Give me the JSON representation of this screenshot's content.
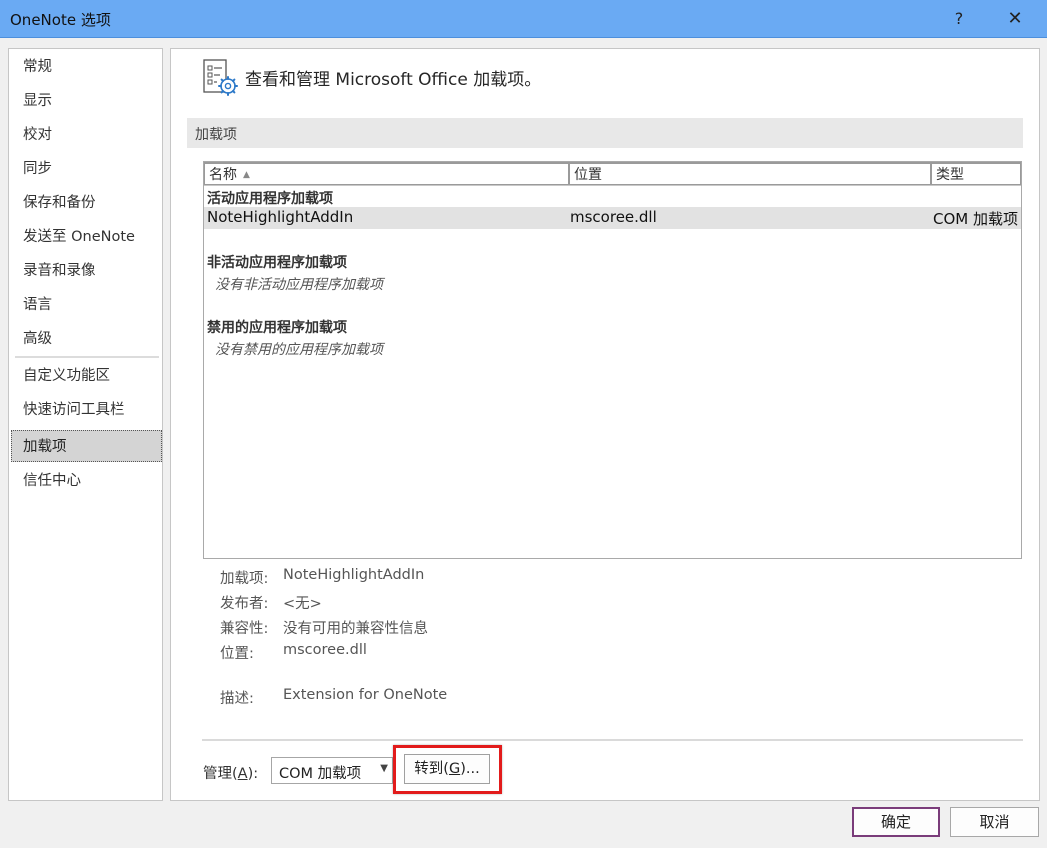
{
  "window": {
    "title": "OneNote 选项",
    "help": "?",
    "close": "✕"
  },
  "nav": {
    "items": [
      "常规",
      "显示",
      "校对",
      "同步",
      "保存和备份",
      "发送至 OneNote",
      "录音和录像",
      "语言",
      "高级",
      "自定义功能区",
      "快速访问工具栏",
      "加载项",
      "信任中心"
    ],
    "active": "加载项"
  },
  "main": {
    "heading": "查看和管理 Microsoft Office 加载项。",
    "section_title": "加载项",
    "columns": {
      "name": "名称",
      "location": "位置",
      "type": "类型"
    },
    "groups": {
      "active": "活动应用程序加载项",
      "inactive": "非活动应用程序加载项",
      "inactive_empty": "没有非活动应用程序加载项",
      "disabled": "禁用的应用程序加载项",
      "disabled_empty": "没有禁用的应用程序加载项"
    },
    "active_rows": [
      {
        "name": "NoteHighlightAddIn",
        "location": "mscoree.dll",
        "type": "COM 加载项"
      }
    ],
    "details": {
      "addin_label": "加载项:",
      "addin_value": "NoteHighlightAddIn",
      "publisher_label": "发布者:",
      "publisher_value": "<无>",
      "compat_label": "兼容性:",
      "compat_value": "没有可用的兼容性信息",
      "location_label": "位置:",
      "location_value": "mscoree.dll",
      "desc_label": "描述:",
      "desc_value": "Extension for OneNote"
    },
    "manage": {
      "label_prefix": "管理(",
      "label_key": "A",
      "label_suffix": "):",
      "selected": "COM 加载项",
      "go_prefix": "转到(",
      "go_key": "G",
      "go_suffix": ")..."
    }
  },
  "footer": {
    "ok": "确定",
    "cancel": "取消"
  },
  "colors": {
    "titlebar": "#6aaaf3",
    "highlight_box": "#e21b1b",
    "ok_border": "#7a3c7a"
  },
  "icons": {
    "header": "addin-settings-icon",
    "sort": "sort-ascending-icon",
    "dropdown": "dropdown-arrow-icon"
  }
}
